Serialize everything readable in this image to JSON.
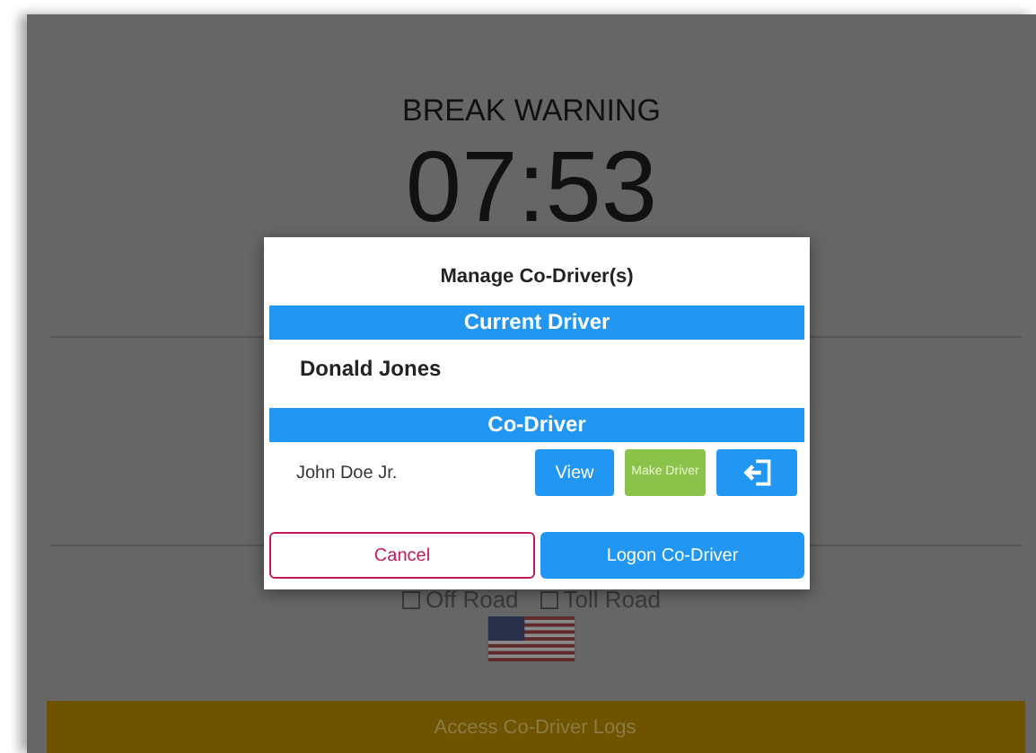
{
  "screen": {
    "title": "BREAK WARNING",
    "timer": "07:53"
  },
  "options": [
    {
      "label": "Off Road",
      "checked": false
    },
    {
      "label": "Toll Road",
      "checked": false
    }
  ],
  "access_button": "Access Co-Driver Logs",
  "dialog": {
    "title": "Manage Co-Driver(s)",
    "current_header": "Current Driver",
    "current_driver": "Donald Jones",
    "co_header": "Co-Driver",
    "co_drivers": [
      {
        "name": "John Doe Jr.",
        "view": "View",
        "make": "Make Driver"
      }
    ],
    "cancel": "Cancel",
    "logon": "Logon Co-Driver"
  }
}
